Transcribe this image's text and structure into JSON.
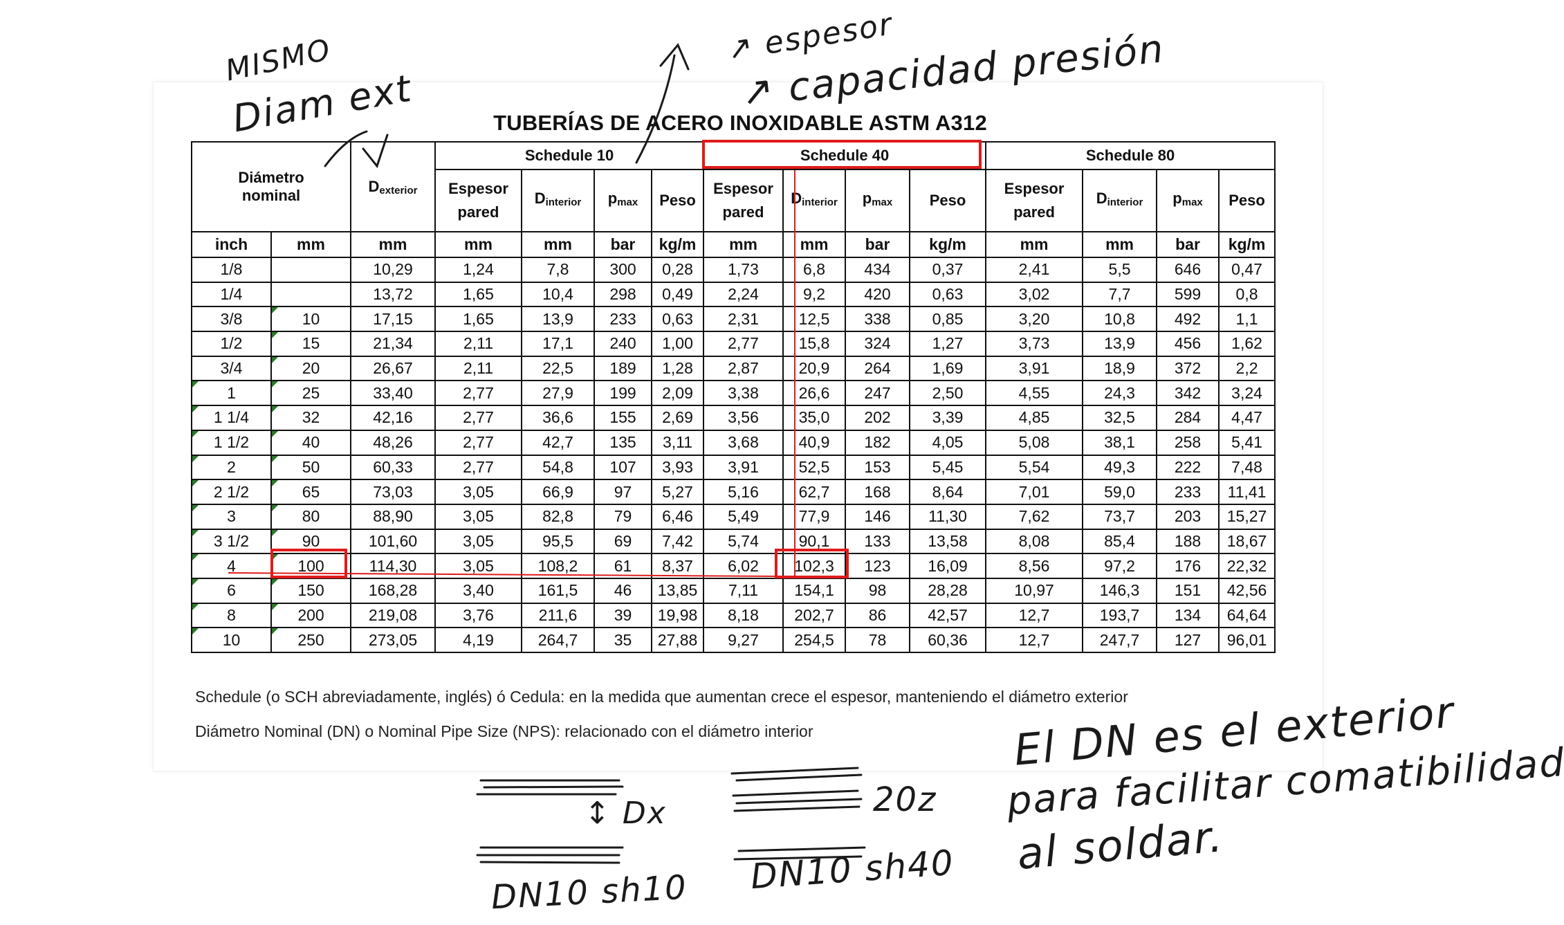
{
  "title": "TUBERÍAS DE ACERO INOXIDABLE  ASTM A312",
  "headers": {
    "nominal": "Diámetro nominal",
    "d_ext_main": "D",
    "d_ext_sub": "exterior",
    "schedules": [
      "Schedule 10",
      "Schedule 40",
      "Schedule 80"
    ],
    "espesor": "Espesor pared",
    "d_int_main": "D",
    "d_int_sub": "interior",
    "p_main": "p",
    "p_sub": "max",
    "peso": "Peso",
    "units": [
      "inch",
      "mm",
      "mm",
      "mm",
      "mm",
      "bar",
      "kg/m",
      "mm",
      "mm",
      "bar",
      "kg/m",
      "mm",
      "mm",
      "bar",
      "kg/m"
    ]
  },
  "rows": [
    [
      "1/8",
      "",
      "10,29",
      "1,24",
      "7,8",
      "300",
      "0,28",
      "1,73",
      "6,8",
      "434",
      "0,37",
      "2,41",
      "5,5",
      "646",
      "0,47"
    ],
    [
      "1/4",
      "",
      "13,72",
      "1,65",
      "10,4",
      "298",
      "0,49",
      "2,24",
      "9,2",
      "420",
      "0,63",
      "3,02",
      "7,7",
      "599",
      "0,8"
    ],
    [
      "3/8",
      "10",
      "17,15",
      "1,65",
      "13,9",
      "233",
      "0,63",
      "2,31",
      "12,5",
      "338",
      "0,85",
      "3,20",
      "10,8",
      "492",
      "1,1"
    ],
    [
      "1/2",
      "15",
      "21,34",
      "2,11",
      "17,1",
      "240",
      "1,00",
      "2,77",
      "15,8",
      "324",
      "1,27",
      "3,73",
      "13,9",
      "456",
      "1,62"
    ],
    [
      "3/4",
      "20",
      "26,67",
      "2,11",
      "22,5",
      "189",
      "1,28",
      "2,87",
      "20,9",
      "264",
      "1,69",
      "3,91",
      "18,9",
      "372",
      "2,2"
    ],
    [
      "1",
      "25",
      "33,40",
      "2,77",
      "27,9",
      "199",
      "2,09",
      "3,38",
      "26,6",
      "247",
      "2,50",
      "4,55",
      "24,3",
      "342",
      "3,24"
    ],
    [
      "1 1/4",
      "32",
      "42,16",
      "2,77",
      "36,6",
      "155",
      "2,69",
      "3,56",
      "35,0",
      "202",
      "3,39",
      "4,85",
      "32,5",
      "284",
      "4,47"
    ],
    [
      "1 1/2",
      "40",
      "48,26",
      "2,77",
      "42,7",
      "135",
      "3,11",
      "3,68",
      "40,9",
      "182",
      "4,05",
      "5,08",
      "38,1",
      "258",
      "5,41"
    ],
    [
      "2",
      "50",
      "60,33",
      "2,77",
      "54,8",
      "107",
      "3,93",
      "3,91",
      "52,5",
      "153",
      "5,45",
      "5,54",
      "49,3",
      "222",
      "7,48"
    ],
    [
      "2 1/2",
      "65",
      "73,03",
      "3,05",
      "66,9",
      "97",
      "5,27",
      "5,16",
      "62,7",
      "168",
      "8,64",
      "7,01",
      "59,0",
      "233",
      "11,41"
    ],
    [
      "3",
      "80",
      "88,90",
      "3,05",
      "82,8",
      "79",
      "6,46",
      "5,49",
      "77,9",
      "146",
      "11,30",
      "7,62",
      "73,7",
      "203",
      "15,27"
    ],
    [
      "3 1/2",
      "90",
      "101,60",
      "3,05",
      "95,5",
      "69",
      "7,42",
      "5,74",
      "90,1",
      "133",
      "13,58",
      "8,08",
      "85,4",
      "188",
      "18,67"
    ],
    [
      "4",
      "100",
      "114,30",
      "3,05",
      "108,2",
      "61",
      "8,37",
      "6,02",
      "102,3",
      "123",
      "16,09",
      "8,56",
      "97,2",
      "176",
      "22,32"
    ],
    [
      "6",
      "150",
      "168,28",
      "3,40",
      "161,5",
      "46",
      "13,85",
      "7,11",
      "154,1",
      "98",
      "28,28",
      "10,97",
      "146,3",
      "151",
      "42,56"
    ],
    [
      "8",
      "200",
      "219,08",
      "3,76",
      "211,6",
      "39",
      "19,98",
      "8,18",
      "202,7",
      "86",
      "42,57",
      "12,7",
      "193,7",
      "134",
      "64,64"
    ],
    [
      "10",
      "250",
      "273,05",
      "4,19",
      "264,7",
      "35",
      "27,88",
      "9,27",
      "254,5",
      "78",
      "60,36",
      "12,7",
      "247,7",
      "127",
      "96,01"
    ]
  ],
  "notes": [
    "Schedule (o SCH abreviadamente, inglés) ó Cedula: en la medida que aumentan crece el espesor, manteniendo el diámetro exterior",
    "Diámetro Nominal (DN) o Nominal Pipe Size (NPS): relacionado con el diámetro interior"
  ],
  "handwriting": {
    "top_left_1": "MISMO",
    "top_left_2": "Diam ext",
    "top_mid_1": "↗ espesor",
    "top_mid_2": "↗ capacidad presión",
    "dx_label": "↕ Dx",
    "pipe1_label": "DN10 sh10",
    "pipe2_mark": "20z",
    "pipe2_label": "DN10 sh40",
    "right_line1": "El DN es el exterior",
    "right_line2": "para facilitar comatibilidad",
    "right_line3": "al soldar."
  },
  "colors": {
    "highlight": "#e01b1b",
    "ink": "#1a1a1a",
    "cell_tick": "#2a7a2a"
  }
}
